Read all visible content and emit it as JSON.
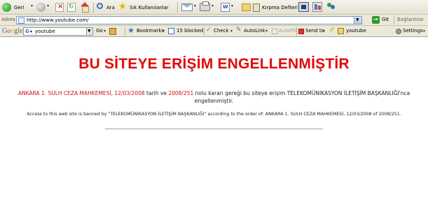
{
  "toolbar": {
    "back_label": "Geri",
    "search_label": "Ara",
    "favorites_label": "Sık Kullanılanlar",
    "clipboard_label": "Kırpma Defteri"
  },
  "address": {
    "label": "Adres",
    "url": "http://www.youtube.com/",
    "go_label": "Git",
    "links_label": "Bağlantılar"
  },
  "google_bar": {
    "logo": "Google",
    "search_value": "youtube",
    "go_label": "Go",
    "bookmarks_label": "Bookmarks",
    "blocked_label": "15 blocked",
    "check_label": "Check",
    "autolink_label": "AutoLink",
    "autofill_label": "AutoFill",
    "sendto_label": "Send to",
    "term_label": "youtube",
    "settings_label": "Settings"
  },
  "page": {
    "headline": "BU SİTEYE ERİŞİM ENGELLENMİŞTİR",
    "court": "ANKARA 1. SULH CEZA MAHKEMESİ",
    "date": "12/03/2008",
    "text_1": "tarih ve",
    "decision_no": "2008/251",
    "text_2": "nolu kararı gereği bu siteye erişim TELEKOMÜNİKASYON İLETİŞİM BAŞKANLIĞI'nca",
    "text_3": "engellenmiştir.",
    "english_notice": "Access to this web site is banned by \"TELEKOMÜNİKASYON İLETİŞİM BAŞKANLIĞI\" according to the order of: ANKARA 1. SULH CEZA MAHKEMESİ, 12/03/2008 of 2008/251."
  },
  "colors": {
    "headline": "#e10a0a",
    "link_red": "#d01010",
    "toolbar_bg": "#ece9d8",
    "go_green": "#2e9b2e"
  }
}
